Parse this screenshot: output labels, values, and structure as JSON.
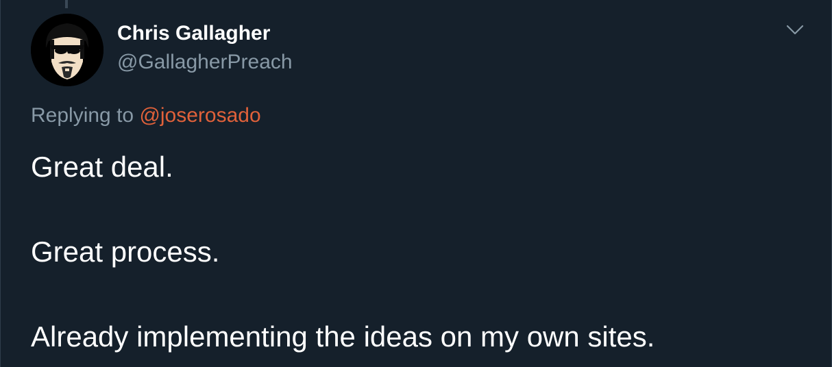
{
  "tweet": {
    "author": {
      "display_name": "Chris Gallagher",
      "handle": "@GallagherPreach",
      "avatar": "cartoon-face-sunglasses-goatee"
    },
    "reply": {
      "prefix": "Replying to",
      "mention": "@joserosado"
    },
    "body_lines": [
      "Great deal.",
      "Great process.",
      "Already implementing the ideas on my own sites."
    ],
    "menu_icon": "chevron-down-icon"
  },
  "colors": {
    "background": "#15202b",
    "primary_text": "#ffffff",
    "secondary_text": "#8899a6",
    "mention": "#e0613a"
  }
}
